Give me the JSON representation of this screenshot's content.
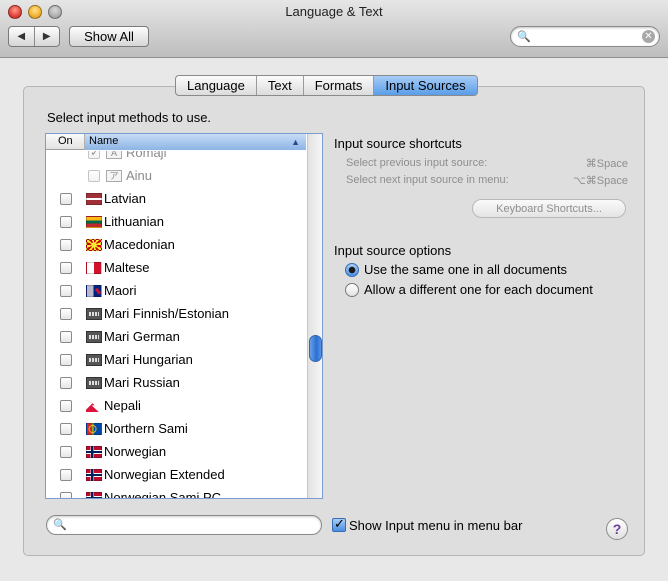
{
  "window": {
    "title": "Language & Text"
  },
  "toolbar": {
    "back_glyph": "◀",
    "forward_glyph": "▶",
    "show_all_label": "Show All",
    "search_value": "",
    "clear_glyph": "✕",
    "search_glyph": "🔍"
  },
  "tabs": [
    {
      "label": "Language",
      "active": false
    },
    {
      "label": "Text",
      "active": false
    },
    {
      "label": "Formats",
      "active": false
    },
    {
      "label": "Input Sources",
      "active": true
    }
  ],
  "main": {
    "select_label": "Select input methods to use.",
    "table": {
      "headers": {
        "on": "On",
        "name": "Name",
        "sort_glyph": "▲"
      },
      "sub_rows": [
        {
          "label": "Romaji",
          "checked": true,
          "icon": "A"
        },
        {
          "label": "Ainu",
          "checked": false,
          "icon": "ア"
        }
      ],
      "rows": [
        {
          "label": "Latvian",
          "checked": false,
          "flag": "latvia-flag"
        },
        {
          "label": "Lithuanian",
          "checked": false,
          "flag": "lithuania-flag"
        },
        {
          "label": "Macedonian",
          "checked": false,
          "flag": "macedonia-flag"
        },
        {
          "label": "Maltese",
          "checked": false,
          "flag": "malta-flag"
        },
        {
          "label": "Maori",
          "checked": false,
          "flag": "new-zealand-flag"
        },
        {
          "label": "Mari Finnish/Estonian",
          "checked": false,
          "flag": "keyboard-icon"
        },
        {
          "label": "Mari German",
          "checked": false,
          "flag": "keyboard-icon"
        },
        {
          "label": "Mari Hungarian",
          "checked": false,
          "flag": "keyboard-icon"
        },
        {
          "label": "Mari Russian",
          "checked": false,
          "flag": "keyboard-icon"
        },
        {
          "label": "Nepali",
          "checked": false,
          "flag": "nepal-flag"
        },
        {
          "label": "Northern Sami",
          "checked": false,
          "flag": "sami-flag"
        },
        {
          "label": "Norwegian",
          "checked": false,
          "flag": "norway-flag"
        },
        {
          "label": "Norwegian Extended",
          "checked": false,
          "flag": "norway-extended-flag"
        },
        {
          "label": "Norwegian Sami PC",
          "checked": false,
          "flag": "norway-flag"
        }
      ]
    }
  },
  "shortcuts": {
    "heading": "Input source shortcuts",
    "items": [
      {
        "label": "Select previous input source:",
        "key": "⌘Space"
      },
      {
        "label": "Select next input source in menu:",
        "key": "⌥⌘Space"
      }
    ],
    "button_label": "Keyboard Shortcuts..."
  },
  "options": {
    "heading": "Input source options",
    "radios": [
      {
        "label": "Use the same one in all documents",
        "selected": true
      },
      {
        "label": "Allow a different one for each document",
        "selected": false
      }
    ]
  },
  "bottom": {
    "search_value": "",
    "search_glyph": "🔍",
    "show_menu_label": "Show Input menu in menu bar",
    "show_menu_checked": true,
    "help_glyph": "?"
  },
  "colors": {
    "accent": "#5a9de8",
    "selection_border": "#7a9ccf",
    "help_purple": "#6b3fa0"
  }
}
